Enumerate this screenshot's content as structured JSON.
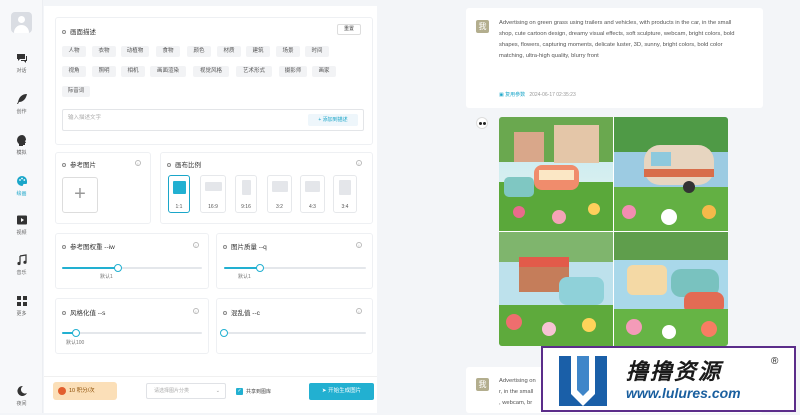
{
  "sidebar": {
    "items": [
      {
        "label": "对话",
        "icon": "chat-icon"
      },
      {
        "label": "创作",
        "icon": "feather-icon"
      },
      {
        "label": "模拟",
        "icon": "brain-icon"
      },
      {
        "label": "绘画",
        "icon": "palette-icon",
        "active": true
      },
      {
        "label": "视频",
        "icon": "video-icon"
      },
      {
        "label": "音乐",
        "icon": "music-icon"
      },
      {
        "label": "更多",
        "icon": "grid-icon"
      }
    ],
    "theme_label": "夜间"
  },
  "description": {
    "title": "画面描述",
    "reset": "重置",
    "tags": [
      "人物",
      "衣物",
      "动植物",
      "食物",
      "颜色",
      "材质",
      "建筑",
      "场景",
      "时间",
      "视角",
      "照明",
      "相机",
      "画面渲染",
      "视觉风格",
      "艺术形式",
      "摄影师",
      "画家",
      "际音词"
    ],
    "placeholder": "输入描述文字",
    "add_label": "+ 添加到描述"
  },
  "reference": {
    "title": "参考图片",
    "upload": "+"
  },
  "aspect": {
    "title": "画布比例",
    "options": [
      "1:1",
      "16:9",
      "9:16",
      "3:2",
      "4:3",
      "3:4"
    ],
    "selected": "1:1"
  },
  "sliders": [
    {
      "title": "参考图权重 --iw",
      "default_label": "默认1",
      "value": 0.4
    },
    {
      "title": "图片质量 --q",
      "default_label": "默认1",
      "value": 0.25
    },
    {
      "title": "风格化值 --s",
      "default_label": "默认100",
      "value": 0.1
    },
    {
      "title": "混乱值 --c",
      "default_label": "",
      "value": 0.0
    }
  ],
  "bottom": {
    "credits": "10 积分/次",
    "select_placeholder": "请选择图片分类",
    "share_label": "共享到图库",
    "share_checked": true,
    "generate": "开始生成图片"
  },
  "messages": [
    {
      "user_avatar": "我",
      "prompt": "Advertising on green grass using trailers and vehicles, with products in the car, in the small shop, cute cartoon design, dreamy visual effects, soft sculpture, webcam, bright colors, bold shapes, flowers, capturing moments, delicate luster, 3D, sunny, bright colors, bold color matching, ultra-high quality, blurry front",
      "reuse": "复用参数",
      "time": "2024-06-17 02:35:23"
    },
    {
      "user_avatar": "我",
      "prompt_line1": "Advertising on",
      "prompt_line2": "r, in the small",
      "prompt_line3": ", webcam, br"
    }
  ],
  "watermark": {
    "title": "撸撸资源",
    "url": "www.lulures.com",
    "reg": "®"
  },
  "colors": {
    "accent": "#22b0d1",
    "credits_bg": "#fbdfb8",
    "watermark_border": "#5b2d8a"
  }
}
